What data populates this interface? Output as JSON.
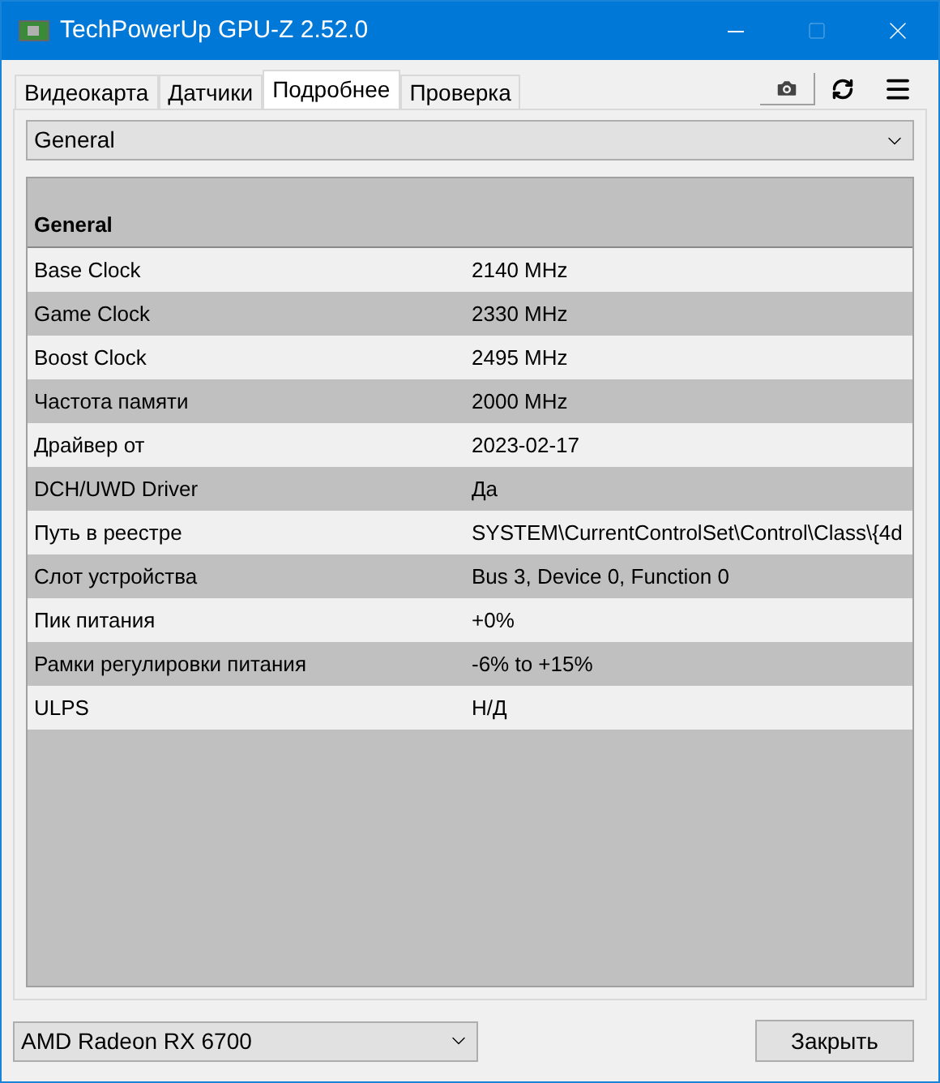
{
  "window": {
    "title": "TechPowerUp GPU-Z 2.52.0"
  },
  "tabs": [
    {
      "label": "Видеокарта",
      "selected": false
    },
    {
      "label": "Датчики",
      "selected": false
    },
    {
      "label": "Подробнее",
      "selected": true
    },
    {
      "label": "Проверка",
      "selected": false
    }
  ],
  "section_select": {
    "value": "General"
  },
  "table": {
    "heading": "General",
    "rows": [
      {
        "label": "Base Clock",
        "value": "2140 MHz"
      },
      {
        "label": "Game Clock",
        "value": "2330 MHz"
      },
      {
        "label": "Boost Clock",
        "value": "2495 MHz"
      },
      {
        "label": "Частота памяти",
        "value": "2000 MHz"
      },
      {
        "label": "Драйвер от",
        "value": "2023-02-17"
      },
      {
        "label": "DCH/UWD Driver",
        "value": "Да"
      },
      {
        "label": "Путь в реестре",
        "value": "SYSTEM\\CurrentControlSet\\Control\\Class\\{4d"
      },
      {
        "label": "Слот устройства",
        "value": "Bus 3, Device 0, Function 0"
      },
      {
        "label": "Пик питания",
        "value": "+0%"
      },
      {
        "label": "Рамки регулировки питания",
        "value": "-6% to +15%"
      },
      {
        "label": "ULPS",
        "value": "Н/Д"
      }
    ]
  },
  "gpu_select": {
    "value": "AMD Radeon RX 6700"
  },
  "close_button": {
    "label": "Закрыть"
  }
}
